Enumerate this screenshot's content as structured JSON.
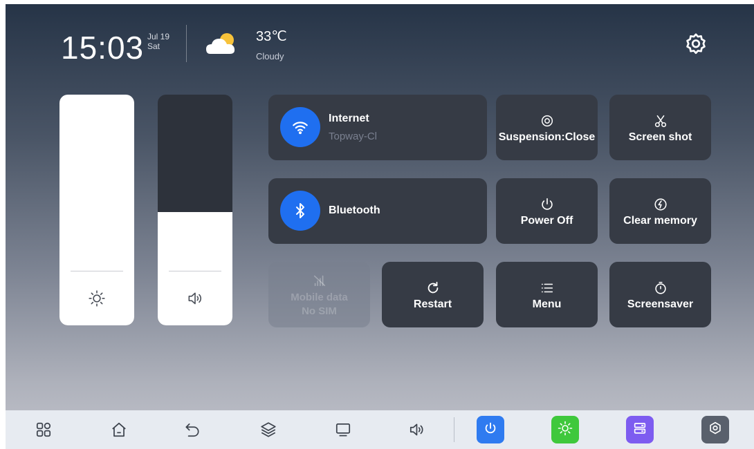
{
  "status": {
    "time": "15:03",
    "date": "Jul 19",
    "weekday": "Sat",
    "temperature": "33℃",
    "condition": "Cloudy",
    "weather_icon": "partly-cloudy-icon"
  },
  "sliders": {
    "brightness": {
      "level": 1.0,
      "icon": "sun-icon"
    },
    "volume": {
      "level": 0.49,
      "icon": "speaker-icon"
    }
  },
  "tiles": {
    "internet": {
      "label": "Internet",
      "sublabel": "Topway-Cl",
      "icon": "wifi-icon",
      "accent": "#1f6ff0"
    },
    "bluetooth": {
      "label": "Bluetooth",
      "icon": "bluetooth-icon",
      "accent": "#1f6ff0"
    },
    "suspension": {
      "label": "Suspension:Close",
      "icon": "target-icon"
    },
    "screenshot": {
      "label": "Screen shot",
      "icon": "scissors-icon"
    },
    "power_off": {
      "label": "Power Off",
      "icon": "power-icon"
    },
    "clear_memory": {
      "label": "Clear memory",
      "icon": "lightning-circle-icon"
    },
    "mobile_data": {
      "label": "Mobile data",
      "sublabel": "No SIM",
      "icon": "signal-off-icon",
      "disabled": true
    },
    "restart": {
      "label": "Restart",
      "icon": "refresh-icon"
    },
    "menu": {
      "label": "Menu",
      "icon": "list-icon"
    },
    "screensaver": {
      "label": "Screensaver",
      "icon": "timer-icon"
    }
  },
  "navbar": {
    "items": [
      "apps-icon",
      "home-icon",
      "back-icon",
      "layers-icon",
      "monitor-icon",
      "volume-icon"
    ],
    "apps": [
      {
        "icon": "power-icon",
        "color": "#2f7bf0"
      },
      {
        "icon": "sun-icon",
        "color": "#3fc83c"
      },
      {
        "icon": "storage-icon",
        "color": "#7d5cf0"
      },
      {
        "icon": "settings-icon",
        "color": "#59606c"
      }
    ]
  }
}
